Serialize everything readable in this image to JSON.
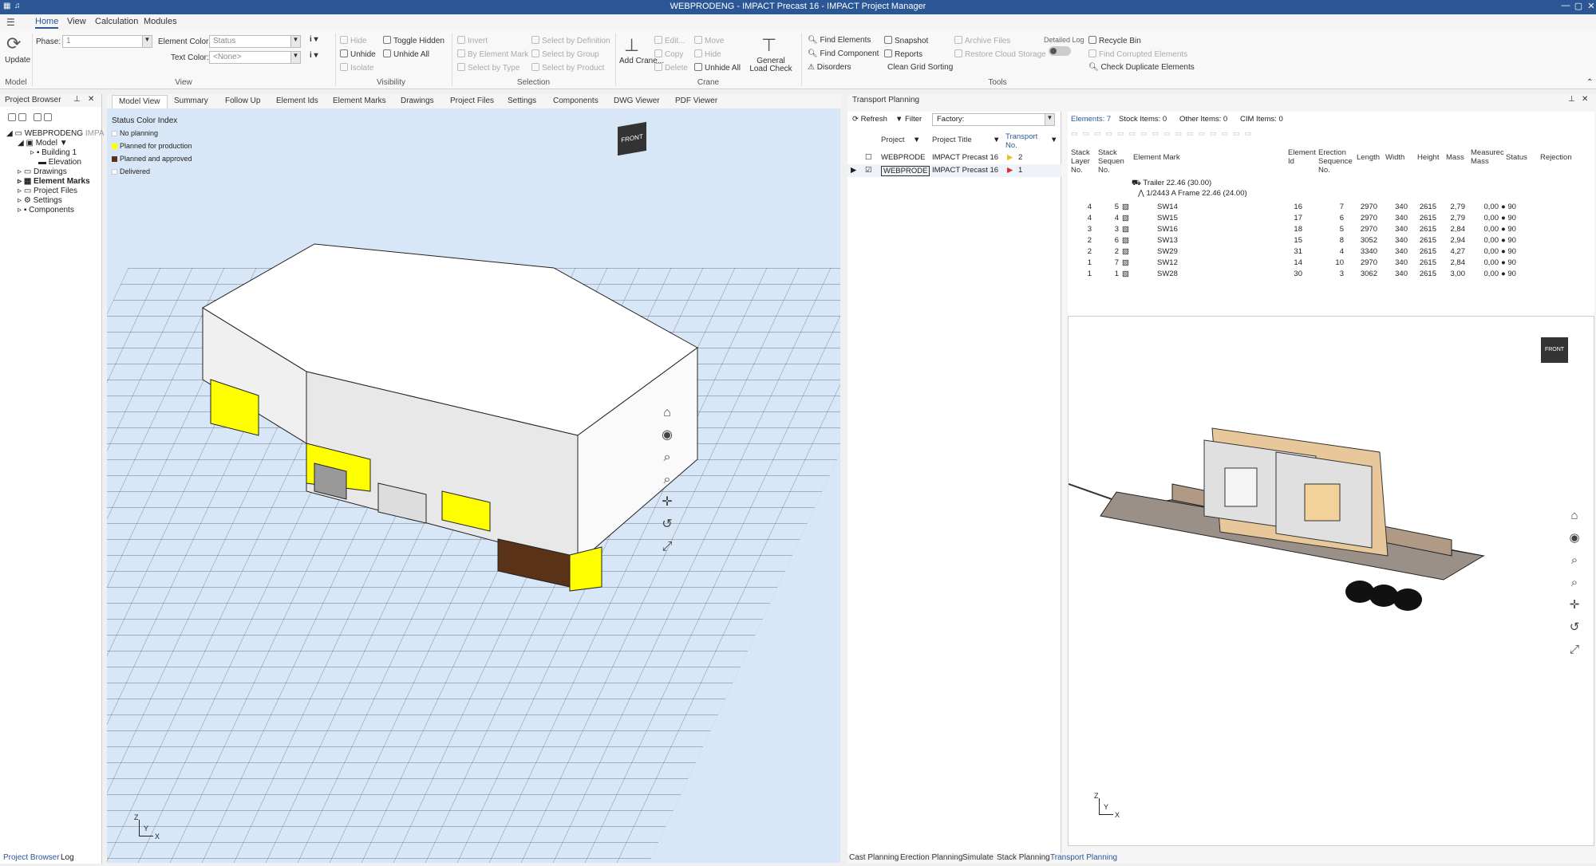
{
  "window": {
    "title": "WEBPRODENG - IMPACT Precast 16 - IMPACT Project Manager"
  },
  "menu": {
    "home": "Home",
    "view": "View",
    "calculation": "Calculation",
    "modules": "Modules"
  },
  "ribbon": {
    "update": "Update",
    "model_group": "Model",
    "phase_label": "Phase:",
    "phase_value": "1",
    "element_color_label": "Element Color:",
    "element_color_value": "Status",
    "text_color_label": "Text Color:",
    "text_color_value": "<None>",
    "view_group": "View",
    "hide": "Hide",
    "unhide": "Unhide",
    "isolate": "Isolate",
    "toggle_hidden": "Toggle Hidden",
    "unhide_all": "Unhide All",
    "visibility_group": "Visibility",
    "invert": "Invert",
    "by_element_mark": "By Element Mark",
    "select_by_type": "Select by Type",
    "select_by_definition": "Select by Definition",
    "select_by_group": "Select by Group",
    "select_by_product": "Select by Product",
    "selection_group": "Selection",
    "add_crane": "Add Crane...",
    "edit": "Edit...",
    "copy": "Copy",
    "delete": "Delete",
    "move": "Move",
    "hide2": "Hide",
    "unhide_all2": "Unhide All",
    "general_load_check": "General Load Check",
    "crane_group": "Crane",
    "find_elements": "Find Elements",
    "find_component": "Find Component",
    "disorders": "Disorders",
    "snapshot": "Snapshot",
    "reports": "Reports",
    "clean_grid_sorting": "Clean Grid Sorting",
    "archive_files": "Archive Files",
    "restore_cloud_storage": "Restore Cloud Storage",
    "detailed_log": "Detailed Log",
    "recycle_bin": "Recycle Bin",
    "find_corrupted": "Find Corrupted Elements",
    "check_duplicate": "Check Duplicate Elements",
    "tools_group": "Tools"
  },
  "project_browser": {
    "title": "Project Browser",
    "items": [
      "WEBPRODENG",
      "IMPA",
      "Model",
      "Building 1",
      "Elevation",
      "Drawings",
      "Element Marks",
      "Project Files",
      "Settings",
      "Components"
    ],
    "bottom_tabs": [
      "Project Browser",
      "Log"
    ]
  },
  "main_tabs": [
    "Model View",
    "Summary",
    "Follow Up",
    "Element Ids",
    "Element Marks",
    "Drawings",
    "Project Files",
    "Settings",
    "Components",
    "DWG Viewer",
    "PDF Viewer"
  ],
  "legend": {
    "title": "Status Color Index",
    "items": [
      {
        "label": "No planning",
        "color": "#ffffff"
      },
      {
        "label": "Planned for production",
        "color": "#ffff00"
      },
      {
        "label": "Planned and approved",
        "color": "#5a3218"
      },
      {
        "label": "Delivered",
        "color": "#ffffff"
      }
    ]
  },
  "transport": {
    "title": "Transport Planning",
    "refresh": "Refresh",
    "filter": "Filter",
    "factory_label": "Factory:",
    "col_project": "Project",
    "col_title": "Project Title",
    "col_transport": "Transport No.",
    "rows": [
      {
        "project": "WEBPRODE",
        "title": "IMPACT Precast 16",
        "no": "2",
        "color": "#e8c020"
      },
      {
        "project": "WEBPRODE",
        "title": "IMPACT Precast 16",
        "no": "1",
        "color": "#e03030"
      }
    ],
    "counts": {
      "elements": "Elements: 7",
      "stock": "Stock Items: 0",
      "other": "Other Items: 0",
      "cim": "CIM Items: 0"
    },
    "headers": [
      "Stack Layer No.",
      "Stack Sequen No.",
      "Element Mark",
      "Element Id",
      "Erection Sequence No.",
      "Length",
      "Width",
      "Height",
      "Mass",
      "Measurec Mass",
      "Status",
      "Rejection"
    ],
    "trailer": "Trailer 22.46 (30.00)",
    "frame": "1/2443 A Frame 22.46 (24.00)",
    "elements": [
      {
        "layer": "4",
        "seq": "5",
        "mark": "SW14",
        "id": "16",
        "erect": "7",
        "len": "2970",
        "wid": "340",
        "hgt": "2615",
        "mass": "2,79",
        "meas": "0,00",
        "status": "90"
      },
      {
        "layer": "4",
        "seq": "4",
        "mark": "SW15",
        "id": "17",
        "erect": "6",
        "len": "2970",
        "wid": "340",
        "hgt": "2615",
        "mass": "2,79",
        "meas": "0,00",
        "status": "90"
      },
      {
        "layer": "3",
        "seq": "3",
        "mark": "SW16",
        "id": "18",
        "erect": "5",
        "len": "2970",
        "wid": "340",
        "hgt": "2615",
        "mass": "2,84",
        "meas": "0,00",
        "status": "90"
      },
      {
        "layer": "2",
        "seq": "6",
        "mark": "SW13",
        "id": "15",
        "erect": "8",
        "len": "3052",
        "wid": "340",
        "hgt": "2615",
        "mass": "2,94",
        "meas": "0,00",
        "status": "90"
      },
      {
        "layer": "2",
        "seq": "2",
        "mark": "SW29",
        "id": "31",
        "erect": "4",
        "len": "3340",
        "wid": "340",
        "hgt": "2615",
        "mass": "4,27",
        "meas": "0,00",
        "status": "90"
      },
      {
        "layer": "1",
        "seq": "7",
        "mark": "SW12",
        "id": "14",
        "erect": "10",
        "len": "2970",
        "wid": "340",
        "hgt": "2615",
        "mass": "2,84",
        "meas": "0,00",
        "status": "90"
      },
      {
        "layer": "1",
        "seq": "1",
        "mark": "SW28",
        "id": "30",
        "erect": "3",
        "len": "3062",
        "wid": "340",
        "hgt": "2615",
        "mass": "3,00",
        "meas": "0,00",
        "status": "90"
      }
    ],
    "bottom_tabs": [
      "Cast Planning",
      "Erection Planning",
      "Simulate",
      "Stack Planning",
      "Transport Planning"
    ]
  },
  "viewcube": {
    "label": "FRONT"
  },
  "axes": {
    "x": "X",
    "y": "Y",
    "z": "Z"
  }
}
